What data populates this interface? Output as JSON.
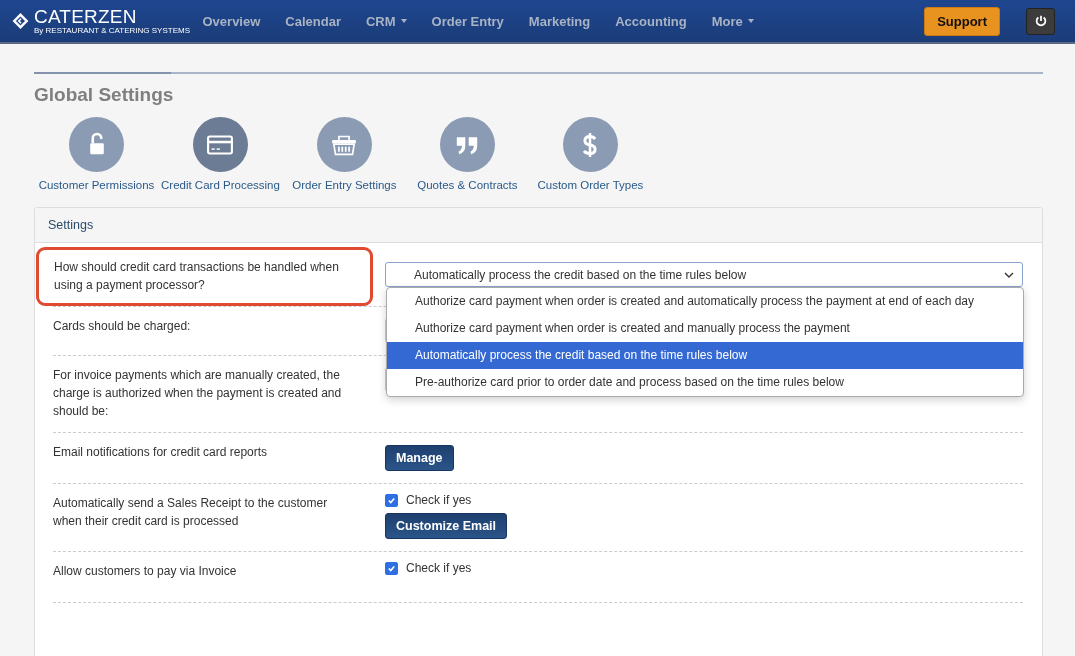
{
  "navbar": {
    "logo": {
      "name": "CATERZEN",
      "tagline": "By RESTAURANT & CATERING SYSTEMS"
    },
    "items": [
      {
        "label": "Overview",
        "dropdown": false
      },
      {
        "label": "Calendar",
        "dropdown": false
      },
      {
        "label": "CRM",
        "dropdown": true
      },
      {
        "label": "Order Entry",
        "dropdown": false
      },
      {
        "label": "Marketing",
        "dropdown": false
      },
      {
        "label": "Accounting",
        "dropdown": false
      },
      {
        "label": "More",
        "dropdown": true
      }
    ],
    "support_button": "Support"
  },
  "page_title": "Global Settings",
  "sections": [
    {
      "label": "Customer Permissions",
      "selected": false
    },
    {
      "label": "Credit Card Processing",
      "selected": true
    },
    {
      "label": "Order Entry Settings",
      "selected": false
    },
    {
      "label": "Quotes & Contracts",
      "selected": false
    },
    {
      "label": "Custom Order Types",
      "selected": false
    }
  ],
  "panel": {
    "title": "Settings",
    "rows": [
      {
        "kind": "select",
        "label": "How should credit card transactions be handled when using a payment processor?",
        "highlighted": true,
        "value": "Automatically process the credit based on the time rules below",
        "expanded": true,
        "options": [
          {
            "label": "Authorize card payment when order is created and automatically process the payment at end of each day",
            "selected": false
          },
          {
            "label": "Authorize card payment when order is created and manually process the payment",
            "selected": false
          },
          {
            "label": "Automatically process the credit based on the time rules below",
            "selected": true
          },
          {
            "label": "Pre-authorize card prior to order date and process based on the time rules below",
            "selected": false
          }
        ]
      },
      {
        "kind": "select",
        "label": "Cards should be charged:",
        "highlighted": false
      },
      {
        "kind": "select",
        "label": "For invoice payments which are manually created, the charge is authorized when the payment is created and should be:",
        "highlighted": false
      },
      {
        "kind": "button",
        "label": "Email notifications for credit card reports",
        "highlighted": false,
        "button": "Manage"
      },
      {
        "kind": "checkbox",
        "label": "Automatically send a Sales Receipt to the customer when their credit card is processed",
        "highlighted": false,
        "checked": true,
        "check_label": "Check if yes",
        "button": "Customize Email"
      },
      {
        "kind": "checkbox",
        "label": "Allow customers to pay via Invoice",
        "highlighted": false,
        "checked": true,
        "check_label": "Check if yes"
      }
    ]
  }
}
